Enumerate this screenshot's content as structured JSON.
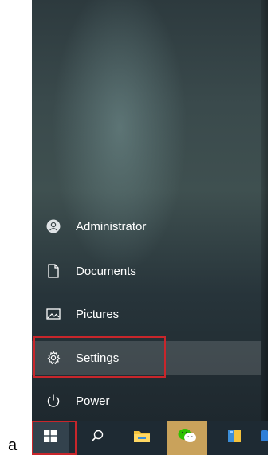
{
  "figure_label": "a",
  "start_menu": {
    "items": [
      {
        "label": "Administrator",
        "icon": "user-avatar-icon"
      },
      {
        "label": "Documents",
        "icon": "document-icon"
      },
      {
        "label": "Pictures",
        "icon": "pictures-icon"
      },
      {
        "label": "Settings",
        "icon": "gear-icon",
        "highlighted": true
      },
      {
        "label": "Power",
        "icon": "power-icon"
      }
    ]
  },
  "taskbar": {
    "buttons": [
      {
        "icon": "windows-start-icon",
        "highlighted": true
      },
      {
        "icon": "search-icon"
      },
      {
        "icon": "file-explorer-icon"
      },
      {
        "icon": "wechat-icon"
      },
      {
        "icon": "archive-app-icon"
      },
      {
        "icon": "edge-icon"
      }
    ]
  },
  "colors": {
    "highlight_border": "#c8262b",
    "taskbar": "#1e2a33",
    "wechat": "#2dc100",
    "folder": "#f4c23c"
  }
}
